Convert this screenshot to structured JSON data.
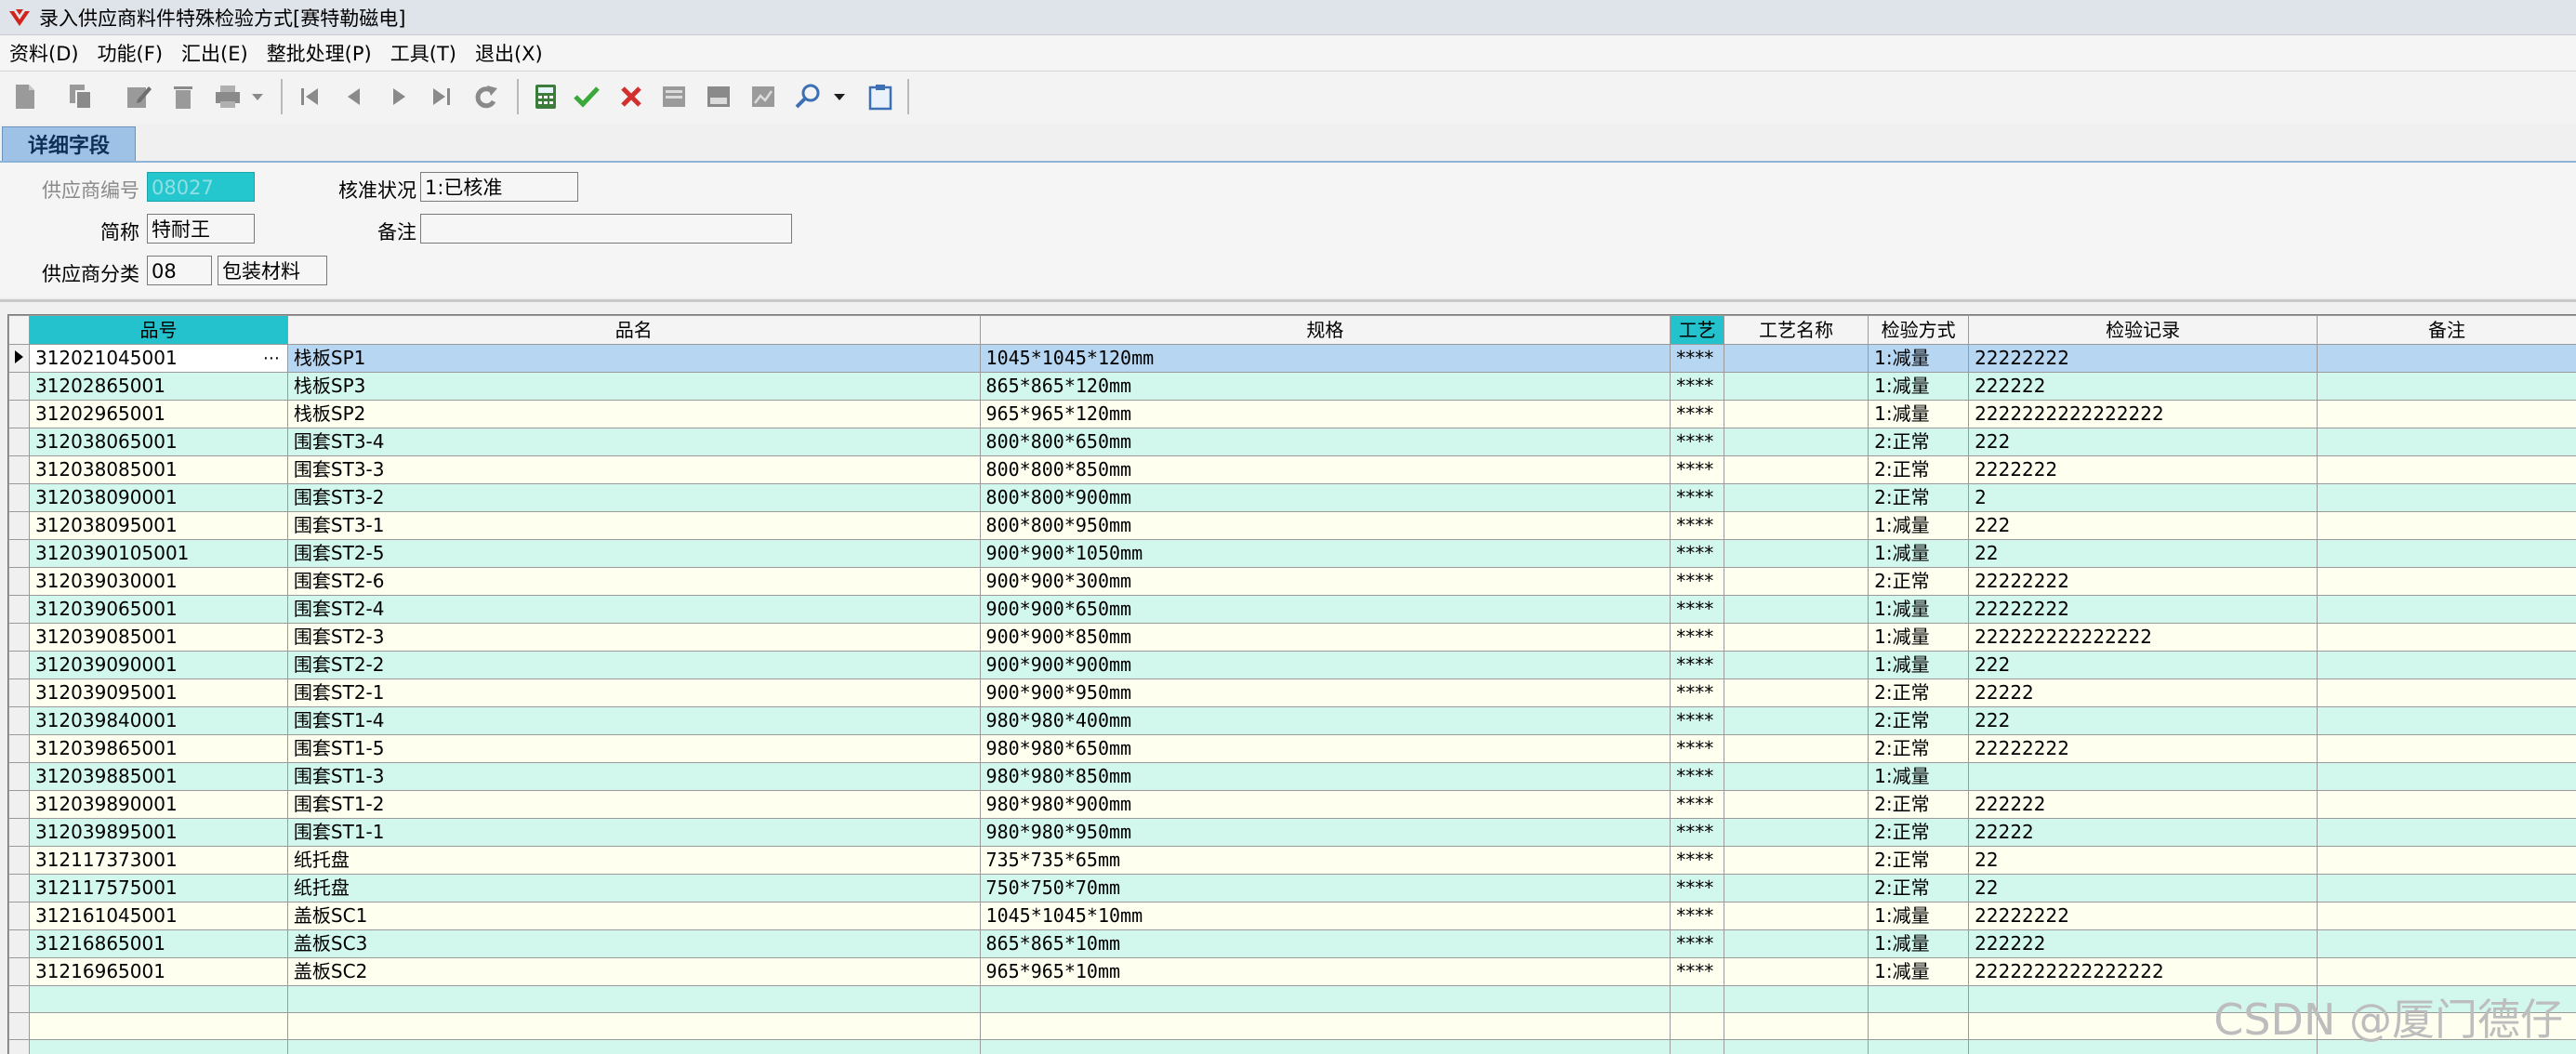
{
  "window": {
    "title": "录入供应商料件特殊检验方式[赛特勒磁电]"
  },
  "menu": [
    "资料(D)",
    "功能(F)",
    "汇出(E)",
    "整批处理(P)",
    "工具(T)",
    "退出(X)"
  ],
  "toolbar_icons": [
    "new-icon",
    "copy-icon",
    "edit-icon",
    "delete-icon",
    "print-icon",
    "dropdown-icon",
    "first-record-icon",
    "previous-record-icon",
    "next-record-icon",
    "last-record-icon",
    "refresh-icon",
    "calculator-icon",
    "confirm-icon",
    "cancel-icon",
    "import-icon",
    "export-icon",
    "report-icon",
    "search-icon",
    "dropdown-icon",
    "clipboard-icon"
  ],
  "tab": {
    "label": "详细字段"
  },
  "form": {
    "supplier_no_label": "供应商编号",
    "supplier_no_value": "08027",
    "approval_status_label": "核准状况",
    "approval_status_value": "1:已核准",
    "short_name_label": "简称",
    "short_name_value": "特耐王",
    "remark_label": "备注",
    "remark_value": "",
    "category_label": "供应商分类",
    "category_code": "08",
    "category_name": "包装材料"
  },
  "grid": {
    "columns": [
      "品号",
      "品名",
      "规格",
      "工艺",
      "工艺名称",
      "检验方式",
      "检验记录",
      "备注"
    ],
    "rows": [
      [
        "312021045001",
        "栈板SP1",
        "1045*1045*120mm",
        "****",
        "",
        "1:减量",
        "22222222",
        ""
      ],
      [
        "31202865001",
        "栈板SP3",
        "865*865*120mm",
        "****",
        "",
        "1:减量",
        "222222",
        ""
      ],
      [
        "31202965001",
        "栈板SP2",
        "965*965*120mm",
        "****",
        "",
        "1:减量",
        "2222222222222222",
        ""
      ],
      [
        "312038065001",
        "围套ST3-4",
        "800*800*650mm",
        "****",
        "",
        "2:正常",
        "222",
        ""
      ],
      [
        "312038085001",
        "围套ST3-3",
        "800*800*850mm",
        "****",
        "",
        "2:正常",
        "2222222",
        ""
      ],
      [
        "312038090001",
        "围套ST3-2",
        "800*800*900mm",
        "****",
        "",
        "2:正常",
        "2",
        ""
      ],
      [
        "312038095001",
        "围套ST3-1",
        "800*800*950mm",
        "****",
        "",
        "1:减量",
        "222",
        ""
      ],
      [
        "3120390105001",
        "围套ST2-5",
        "900*900*1050mm",
        "****",
        "",
        "1:减量",
        "22",
        ""
      ],
      [
        "312039030001",
        "围套ST2-6",
        "900*900*300mm",
        "****",
        "",
        "2:正常",
        "22222222",
        ""
      ],
      [
        "312039065001",
        "围套ST2-4",
        "900*900*650mm",
        "****",
        "",
        "1:减量",
        "22222222",
        ""
      ],
      [
        "312039085001",
        "围套ST2-3",
        "900*900*850mm",
        "****",
        "",
        "1:减量",
        "222222222222222",
        ""
      ],
      [
        "312039090001",
        "围套ST2-2",
        "900*900*900mm",
        "****",
        "",
        "1:减量",
        "222",
        ""
      ],
      [
        "312039095001",
        "围套ST2-1",
        "900*900*950mm",
        "****",
        "",
        "2:正常",
        "22222",
        ""
      ],
      [
        "312039840001",
        "围套ST1-4",
        "980*980*400mm",
        "****",
        "",
        "2:正常",
        "222",
        ""
      ],
      [
        "312039865001",
        "围套ST1-5",
        "980*980*650mm",
        "****",
        "",
        "2:正常",
        "22222222",
        ""
      ],
      [
        "312039885001",
        "围套ST1-3",
        "980*980*850mm",
        "****",
        "",
        "1:减量",
        "",
        ""
      ],
      [
        "312039890001",
        "围套ST1-2",
        "980*980*900mm",
        "****",
        "",
        "2:正常",
        "222222",
        ""
      ],
      [
        "312039895001",
        "围套ST1-1",
        "980*980*950mm",
        "****",
        "",
        "2:正常",
        "22222",
        ""
      ],
      [
        "312117373001",
        "纸托盘",
        "735*735*65mm",
        "****",
        "",
        "2:正常",
        "22",
        ""
      ],
      [
        "312117575001",
        "纸托盘",
        "750*750*70mm",
        "****",
        "",
        "2:正常",
        "22",
        ""
      ],
      [
        "312161045001",
        "盖板SC1",
        "1045*1045*10mm",
        "****",
        "",
        "1:减量",
        "22222222",
        ""
      ],
      [
        "31216865001",
        "盖板SC3",
        "865*865*10mm",
        "****",
        "",
        "1:减量",
        "222222",
        ""
      ],
      [
        "31216965001",
        "盖板SC2",
        "965*965*10mm",
        "****",
        "",
        "1:减量",
        "2222222222222222",
        ""
      ]
    ],
    "empty_rows": 3,
    "selected_row": 0
  },
  "watermark": "CSDN @厦门德仔"
}
